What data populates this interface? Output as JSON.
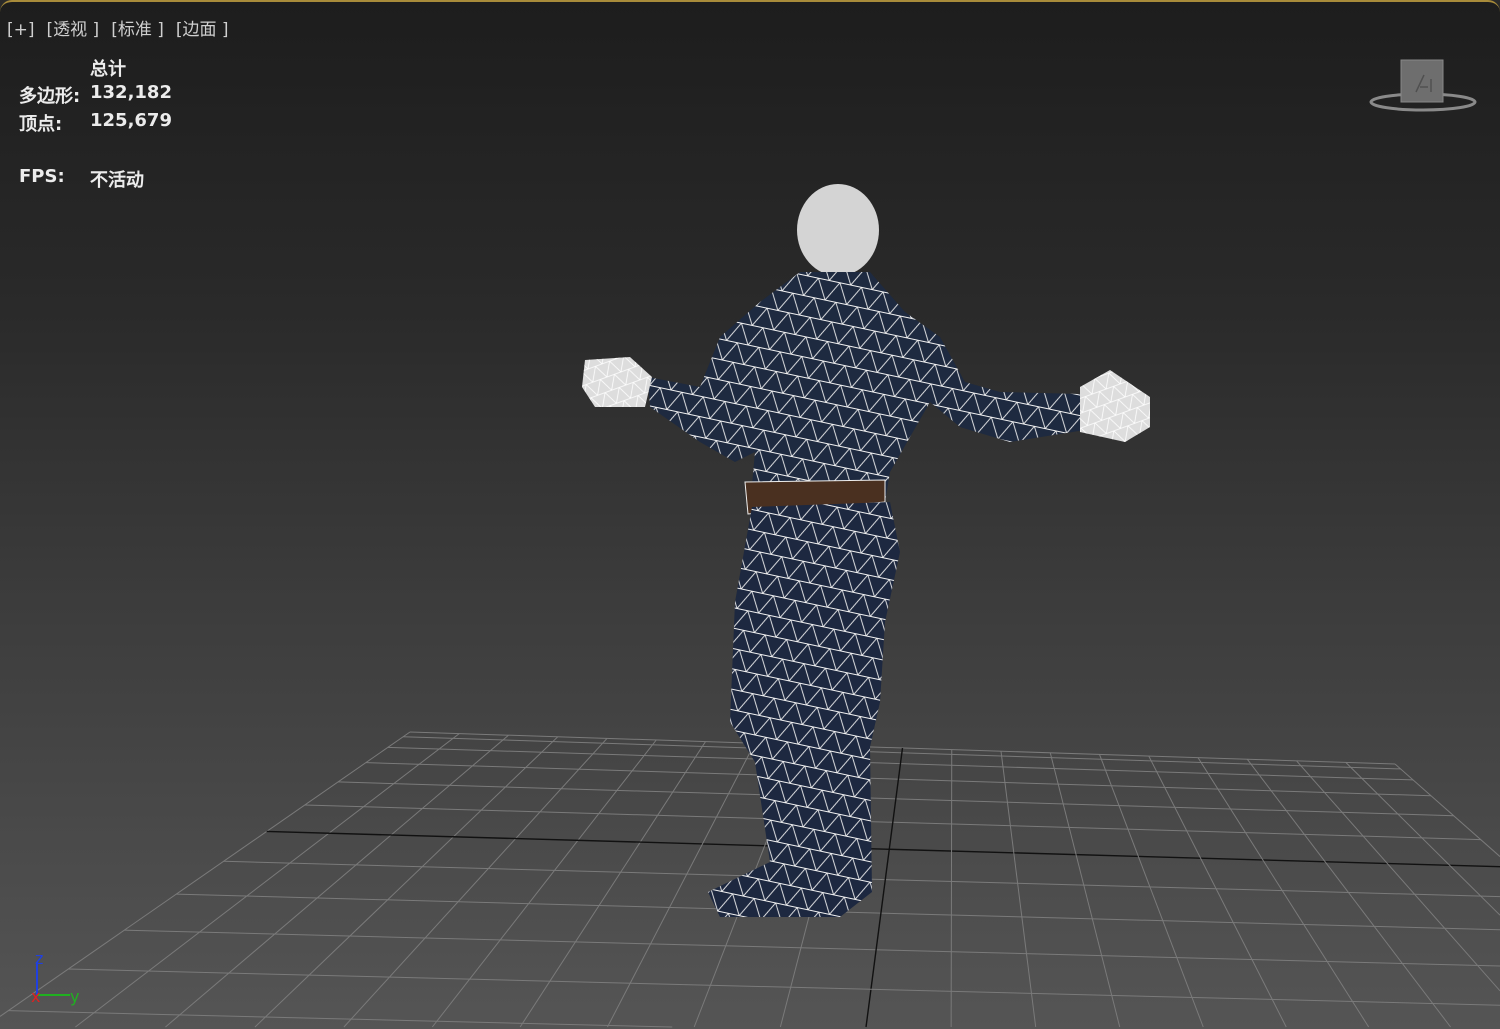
{
  "viewport": {
    "labels": [
      "[+]",
      "[透视 ]",
      "[标准 ]",
      "[边面 ]"
    ],
    "stats": {
      "header": "总计",
      "polygons_label": "多边形:",
      "polygons_value": "132,182",
      "vertices_label": "顶点:",
      "vertices_value": "125,679",
      "fps_label": "FPS:",
      "fps_value": "不活动"
    },
    "axis": {
      "z": "z",
      "x": "x",
      "y": "y"
    },
    "colors": {
      "accent": "#a88b3a",
      "axis_x": "#e02020",
      "axis_y": "#20b020",
      "axis_z": "#2040e0"
    }
  }
}
